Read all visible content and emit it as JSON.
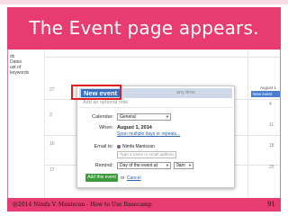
{
  "slide": {
    "title": "The Event page appears.",
    "footer": "@2014 Nimfa V. Maniscan - How to Use Basecamp",
    "page_number": "91"
  },
  "sidebar": {
    "lines": [
      "ds",
      "Dates",
      "ust of",
      "keywords"
    ]
  },
  "calendar": {
    "day_numbers": [
      "27",
      "3",
      "10",
      "17",
      "4",
      "11",
      "18",
      "25"
    ],
    "month_label": "August 1",
    "existing_event": "New event"
  },
  "popup": {
    "title": "New event",
    "any_time": "any time",
    "note_placeholder": "Add an optional note",
    "calendar_label": "Calendar:",
    "calendar_value": "General",
    "when_label": "When:",
    "when_value": "August 1, 2014",
    "when_link": "Span multiple days or repeats...",
    "email_label": "Email to:",
    "email_person": "Nimfa Maniscan",
    "email_placeholder": "Type a name or email address...",
    "remind_label": "Remind:",
    "remind_value": "Day of the event at",
    "remind_time": "9am",
    "add_button": "Add this event",
    "or_text": "or",
    "cancel_link": "Cancel"
  }
}
